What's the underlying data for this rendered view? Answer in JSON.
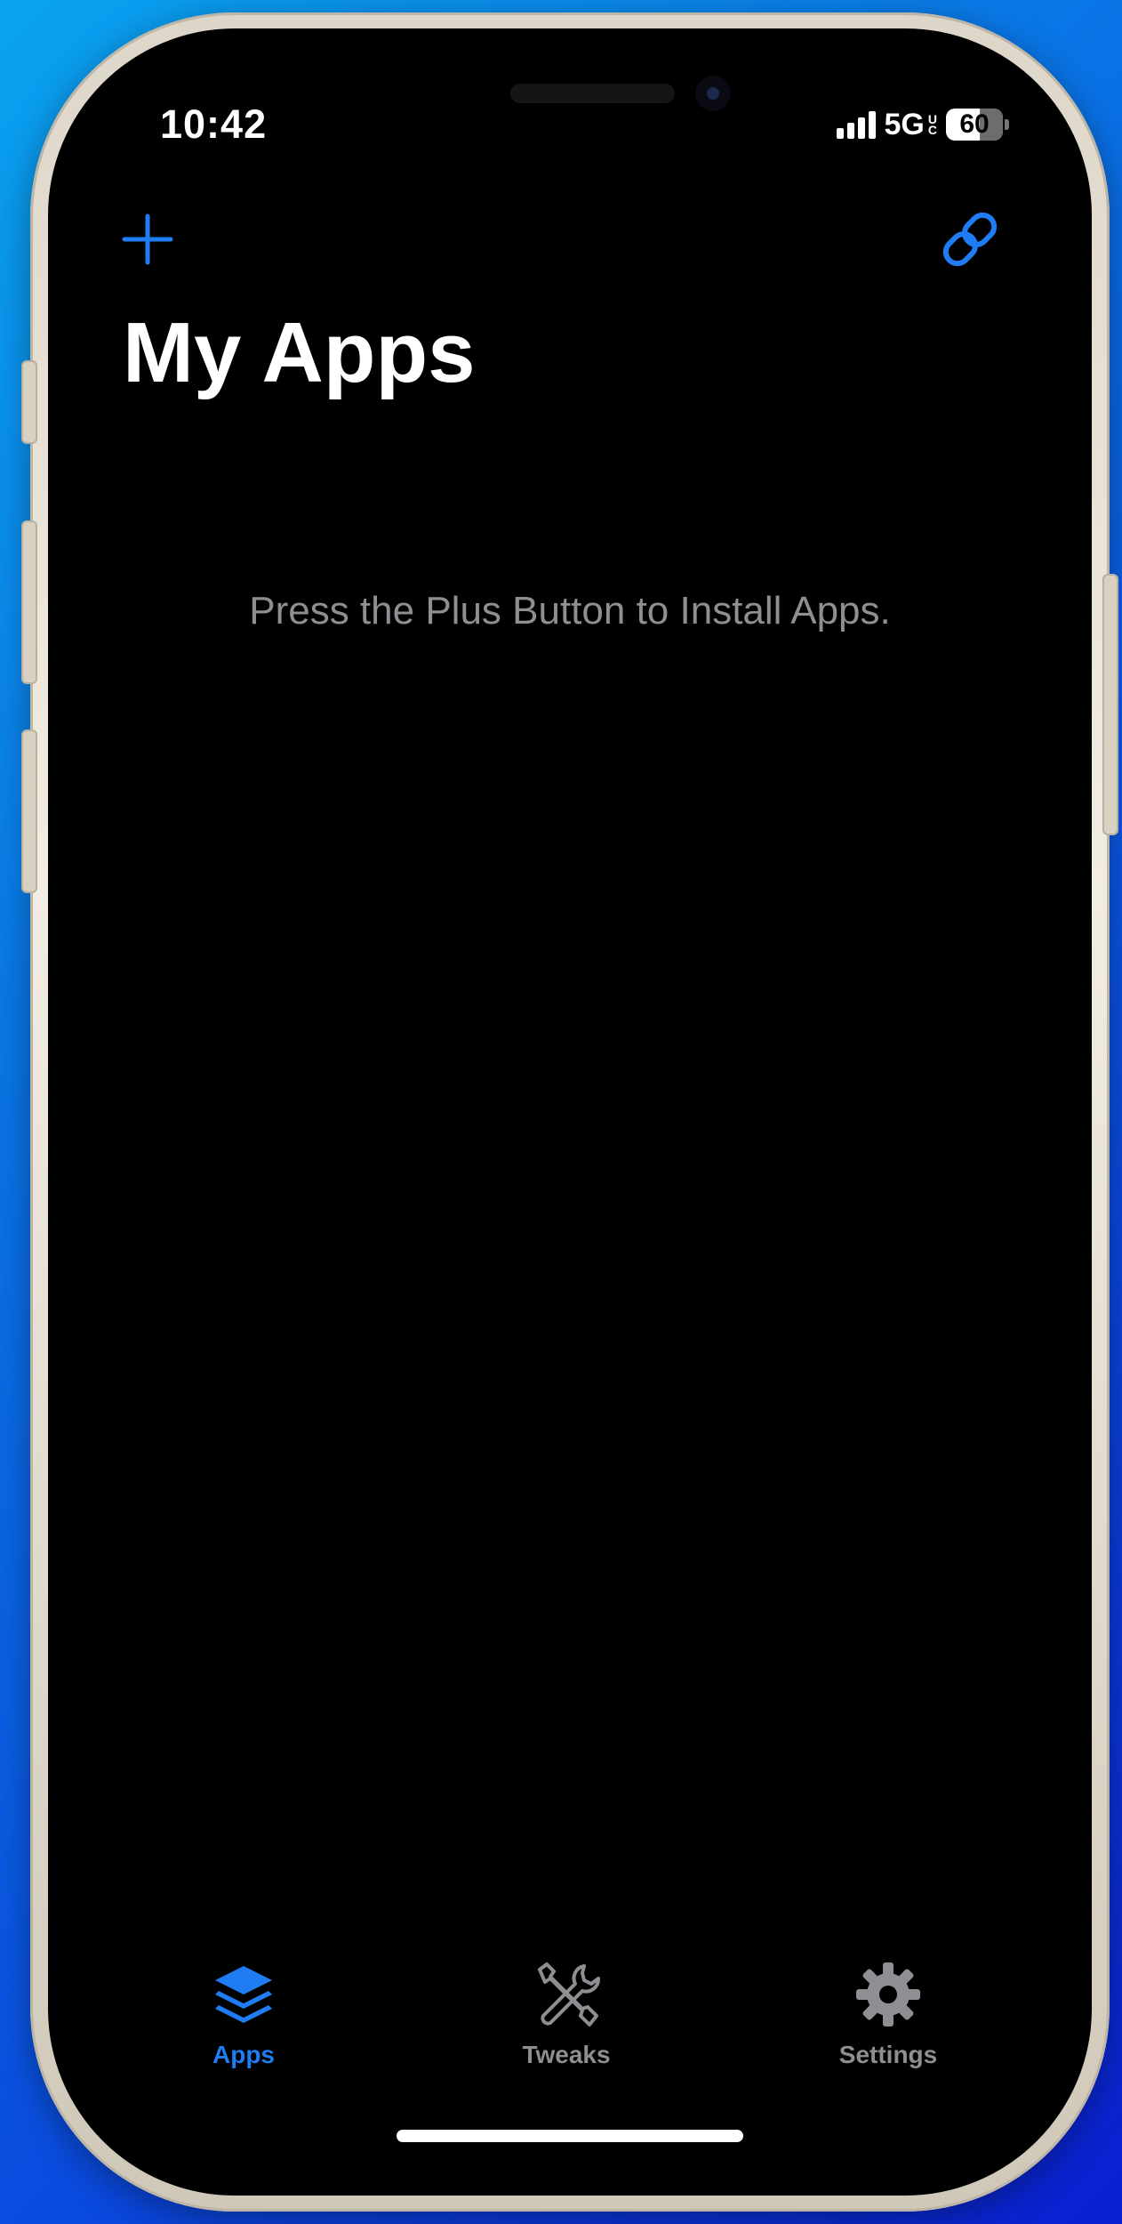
{
  "status_bar": {
    "time": "10:42",
    "network": "5G",
    "network_sup": "U",
    "network_sub": "C",
    "battery": "60"
  },
  "nav": {
    "title": "My Apps",
    "add_icon": "plus-icon",
    "link_icon": "link-icon"
  },
  "main": {
    "empty_message": "Press the Plus Button to Install Apps."
  },
  "tabs": [
    {
      "label": "Apps",
      "icon": "stack-icon",
      "selected": true
    },
    {
      "label": "Tweaks",
      "icon": "wrench-screwdriver-icon",
      "selected": false
    },
    {
      "label": "Settings",
      "icon": "gear-icon",
      "selected": false
    }
  ],
  "colors": {
    "accent": "#1f7cf2",
    "inactive": "#8e8e93",
    "background": "#000000"
  }
}
